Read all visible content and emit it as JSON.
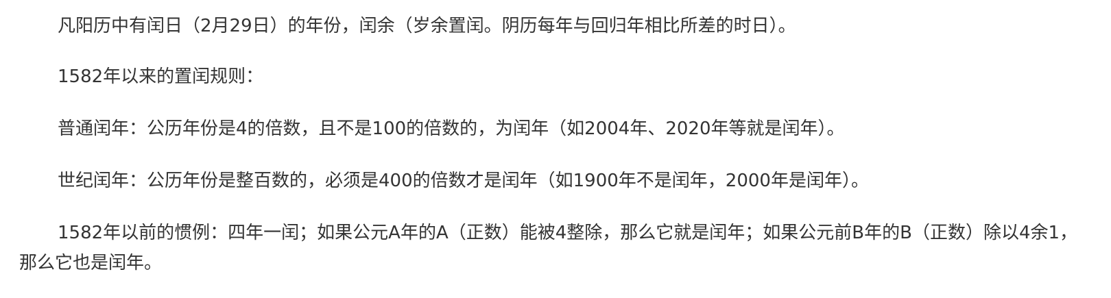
{
  "article": {
    "paragraphs": [
      "凡阳历中有闰日（2月29日）的年份，闰余（岁余置闰。阴历每年与回归年相比所差的时日）。",
      "1582年以来的置闰规则：",
      "普通闰年：公历年份是4的倍数，且不是100的倍数的，为闰年（如2004年、2020年等就是闰年）。",
      "世纪闰年：公历年份是整百数的，必须是400的倍数才是闰年（如1900年不是闰年，2000年是闰年）。",
      "1582年以前的惯例：四年一闰；如果公元A年的A（正数）能被4整除，那么它就是闰年；如果公元前B年的B（正数）除以4余1，那么它也是闰年。"
    ]
  }
}
